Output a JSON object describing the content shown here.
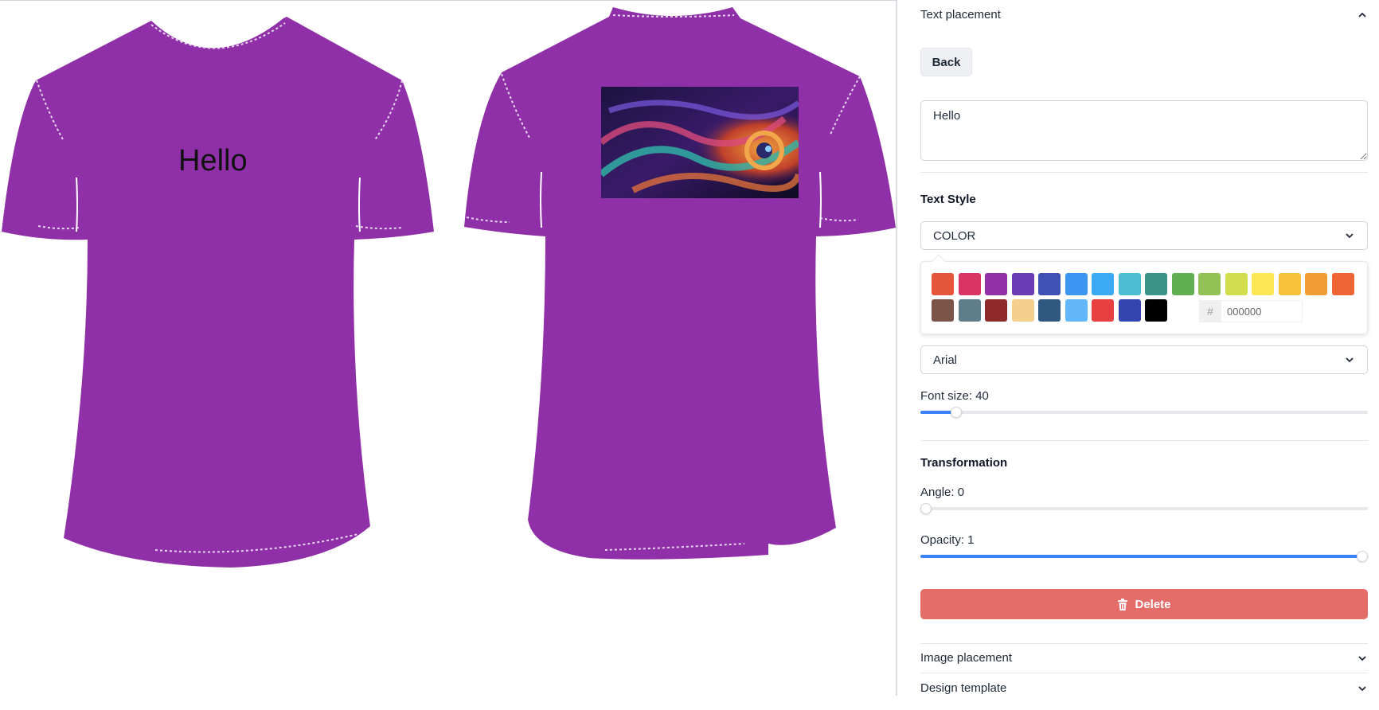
{
  "design": {
    "front_text": "Hello",
    "shirt_color": "#9030a8",
    "stitch_color": "#e6d6ee"
  },
  "panel": {
    "text_placement": {
      "title": "Text placement",
      "icon": "chevron-up-icon"
    },
    "back_label": "Back",
    "text_value": "Hello",
    "text_style": {
      "title": "Text Style",
      "color_select_label": "COLOR",
      "font_select_value": "Arial",
      "font_size_label": "Font size: 40",
      "font_size_fraction": 0.07
    },
    "color_picker": {
      "row1": [
        "#e4553b",
        "#d83465",
        "#9331a8",
        "#6a3bb2",
        "#4051b5",
        "#3d96f2",
        "#3ba9f3",
        "#4cbcd3",
        "#3a9487",
        "#62ae52",
        "#92c155",
        "#d2dd4e",
        "#fbe654",
        "#f6c23c",
        "#f19d35",
        "#ee6435"
      ],
      "row2": [
        "#7a5547",
        "#607d8b",
        "#8e2a29",
        "#f5cf8c",
        "#2e5880",
        "#63b6f8",
        "#e84040",
        "#3545b0",
        "#000000"
      ],
      "hex_prefix": "#",
      "hex_value": "000000"
    },
    "transformation": {
      "title": "Transformation",
      "angle_label": "Angle: 0",
      "angle_fraction": 0.0,
      "opacity_label": "Opacity: 1",
      "opacity_fraction": 1.0
    },
    "delete_label": "Delete",
    "image_placement": {
      "title": "Image placement",
      "icon": "chevron-down-icon"
    },
    "design_template": {
      "title": "Design template",
      "icon": "chevron-down-icon"
    }
  }
}
